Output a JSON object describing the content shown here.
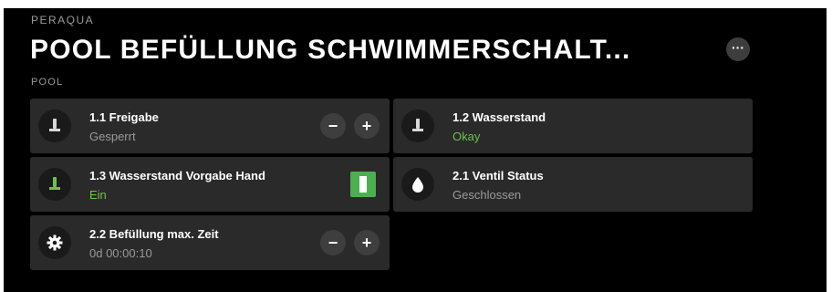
{
  "header": {
    "brand": "PERAQUA",
    "title": "POOL BEFÜLLUNG SCHWIMMERSCHALT...",
    "more_label": "···",
    "section": "POOL"
  },
  "colors": {
    "card_bg": "#2a2a2a",
    "muted_value": "#9a9a9a",
    "ok_green": "#6cc24a",
    "toggle_on": "#4caf50"
  },
  "cards": [
    {
      "label": "1.1 Freigabe",
      "value": "Gesperrt",
      "icon": "switch-icon",
      "minus": "−",
      "plus": "+"
    },
    {
      "label": "1.2 Wasserstand",
      "value": "Okay",
      "icon": "switch-icon"
    },
    {
      "label": "1.3 Wasserstand Vorgabe Hand",
      "value": "Ein",
      "icon": "switch-icon",
      "toggle_state": "on"
    },
    {
      "label": "2.1 Ventil Status",
      "value": "Geschlossen",
      "icon": "water-drop-icon"
    },
    {
      "label": "2.2 Befüllung max. Zeit",
      "value": "0d 00:00:10",
      "icon": "gear-icon",
      "minus": "−",
      "plus": "+"
    }
  ]
}
